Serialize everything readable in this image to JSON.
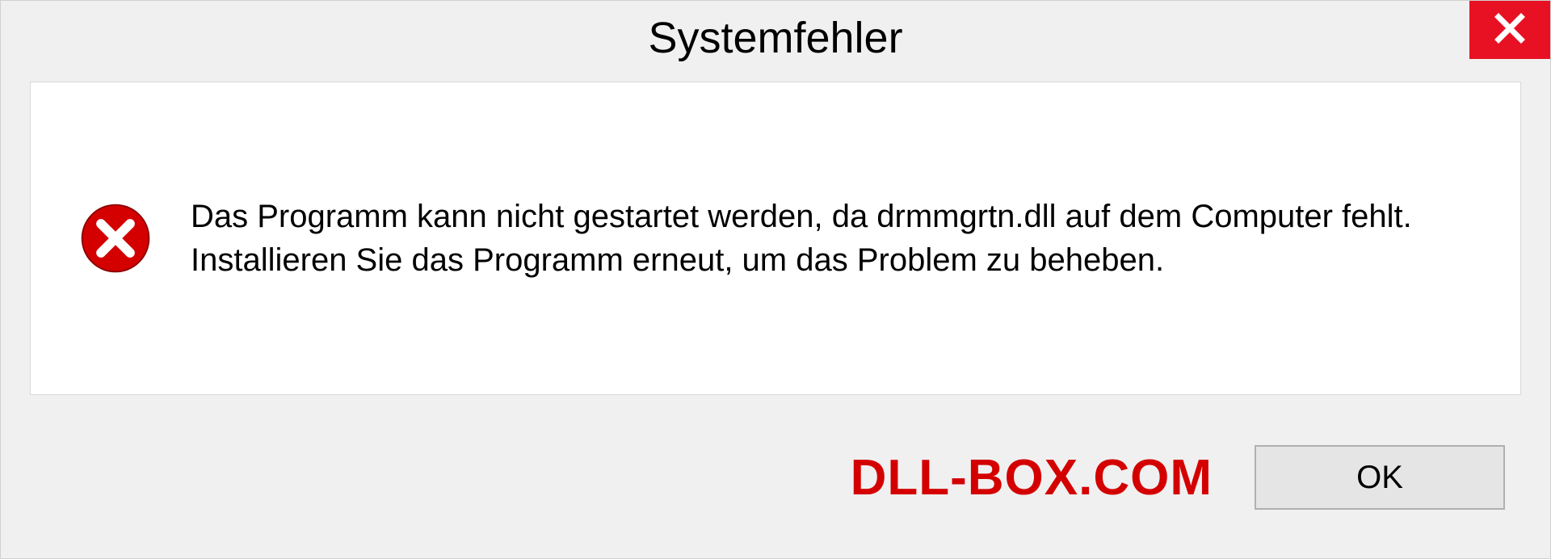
{
  "dialog": {
    "title": "Systemfehler",
    "message": "Das Programm kann nicht gestartet werden, da drmmgrtn.dll auf dem Computer fehlt. Installieren Sie das Programm erneut, um das Problem zu beheben.",
    "ok_label": "OK"
  },
  "watermark": "DLL-BOX.COM",
  "colors": {
    "close_bg": "#e81123",
    "error_icon": "#d40000",
    "watermark": "#d40000"
  }
}
